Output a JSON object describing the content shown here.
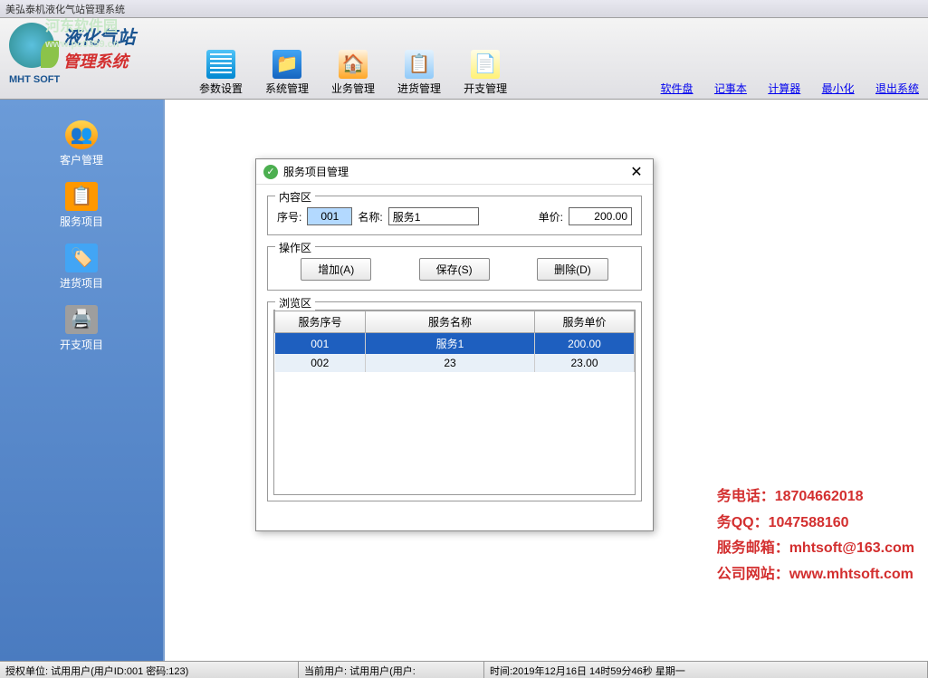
{
  "title_bar": "美弘泰机液化气站管理系统",
  "watermark": "河东软件园",
  "watermark_url": "www.pc0359.cn",
  "logo": {
    "line1": "液化气站",
    "line2": "管理系统",
    "brand": "MHT SOFT"
  },
  "toolbar": {
    "items": [
      {
        "label": "参数设置"
      },
      {
        "label": "系统管理"
      },
      {
        "label": "业务管理"
      },
      {
        "label": "进货管理"
      },
      {
        "label": "开支管理"
      }
    ]
  },
  "top_links": [
    "软件盘",
    "记事本",
    "计算器",
    "最小化",
    "退出系统"
  ],
  "sidebar": {
    "items": [
      {
        "label": "客户管理"
      },
      {
        "label": "服务项目"
      },
      {
        "label": "进货项目"
      },
      {
        "label": "开支项目"
      }
    ]
  },
  "dialog": {
    "title": "服务项目管理",
    "content_section": "内容区",
    "seq_label": "序号:",
    "seq_value": "001",
    "name_label": "名称:",
    "name_value": "服务1",
    "price_label": "单价:",
    "price_value": "200.00",
    "action_section": "操作区",
    "btn_add": "增加(A)",
    "btn_save": "保存(S)",
    "btn_delete": "删除(D)",
    "browse_section": "浏览区",
    "columns": [
      "服务序号",
      "服务名称",
      "服务单价"
    ],
    "rows": [
      {
        "seq": "001",
        "name": "服务1",
        "price": "200.00",
        "selected": true
      },
      {
        "seq": "002",
        "name": "23",
        "price": "23.00",
        "selected": false
      }
    ]
  },
  "contact": {
    "phone": "务电话：18704662018",
    "qq": "务QQ：1047588160",
    "email": "服务邮箱：mhtsoft@163.com",
    "website": "公司网站：www.mhtsoft.com"
  },
  "status": {
    "auth": "授权单位: 试用用户(用户ID:001 密码:123)",
    "user": "当前用户: 试用用户(用户:",
    "time": "时间:2019年12月16日 14时59分46秒 星期一"
  }
}
